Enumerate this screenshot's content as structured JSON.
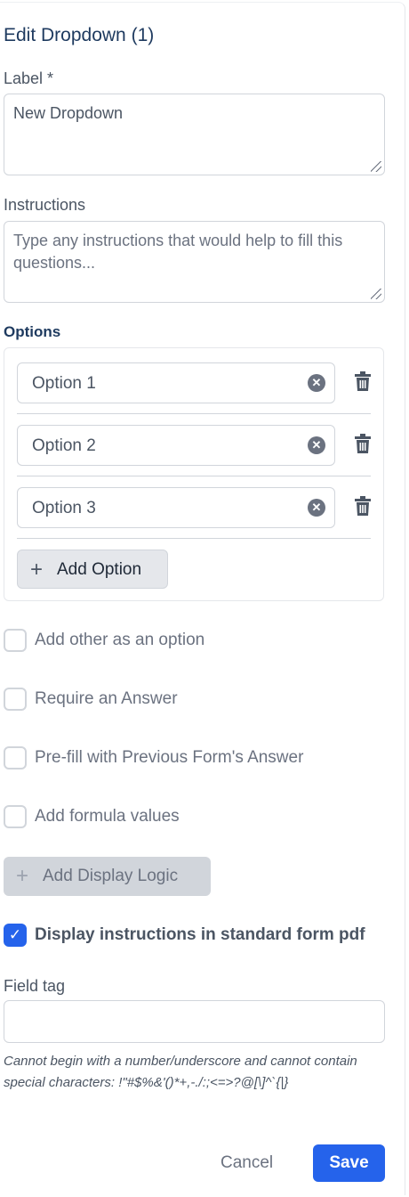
{
  "header": {
    "title": "Edit Dropdown (1)"
  },
  "label_field": {
    "label": "Label *",
    "value": "New Dropdown"
  },
  "instructions_field": {
    "label": "Instructions",
    "placeholder": "Type any instructions that would help to fill this questions..."
  },
  "options_section": {
    "title": "Options",
    "items": [
      {
        "value": "Option 1"
      },
      {
        "value": "Option 2"
      },
      {
        "value": "Option 3"
      }
    ],
    "add_label": "Add Option"
  },
  "checkboxes": [
    {
      "label": "Add other as an option",
      "checked": false
    },
    {
      "label": "Require an Answer",
      "checked": false
    },
    {
      "label": "Pre-fill with Previous Form's Answer",
      "checked": false
    },
    {
      "label": "Add formula values",
      "checked": false
    }
  ],
  "display_logic": {
    "label": "Add Display Logic"
  },
  "display_instructions": {
    "label": "Display instructions in standard form pdf",
    "checked": true
  },
  "field_tag": {
    "label": "Field tag",
    "value": "",
    "hint": "Cannot begin with a number/underscore and cannot contain special characters: !\"#$%&'()*+,-./:;<=>?@[\\]^`{|}"
  },
  "footer": {
    "cancel_label": "Cancel",
    "save_label": "Save"
  },
  "colors": {
    "accent": "#2563eb",
    "title": "#1e3a5f",
    "border": "#d1d5db"
  },
  "icons": {
    "clear": "x-circle-icon",
    "delete": "trash-icon",
    "add": "plus-icon",
    "check": "check-icon"
  }
}
